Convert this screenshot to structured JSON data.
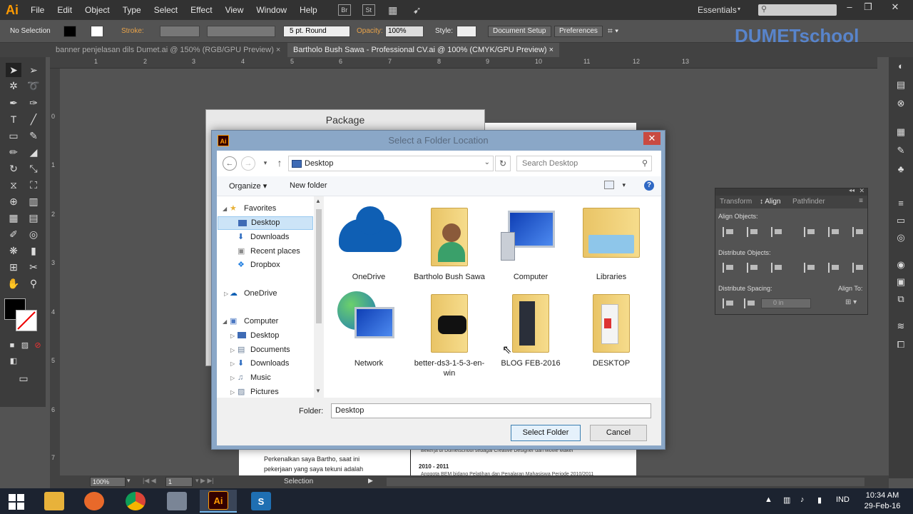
{
  "app": {
    "logo": "Ai",
    "menu": [
      "File",
      "Edit",
      "Object",
      "Type",
      "Select",
      "Effect",
      "View",
      "Window",
      "Help"
    ],
    "mb_icons": [
      "Br",
      "St"
    ],
    "workspace": "Essentials",
    "watermark": "DUMETschool"
  },
  "controlbar": {
    "selection": "No Selection",
    "stroke_label": "Stroke:",
    "brush": "5 pt. Round",
    "opacity_label": "Opacity:",
    "opacity_value": "100%",
    "style_label": "Style:",
    "doc_setup": "Document Setup",
    "preferences": "Preferences"
  },
  "tabs": [
    {
      "label": "banner penjelasan dils Dumet.ai @ 150% (RGB/GPU Preview)  ×"
    },
    {
      "label": "Bartholo Bush Sawa - Professional CV.ai @ 100% (CMYK/GPU Preview)  ×"
    }
  ],
  "ruler": {
    "top": [
      "1",
      "2",
      "3",
      "4",
      "5",
      "6",
      "7",
      "8",
      "9",
      "10",
      "11",
      "12",
      "13"
    ],
    "left": [
      "0",
      "1",
      "2",
      "3",
      "4",
      "5",
      "6",
      "7"
    ]
  },
  "canvas": {
    "text1": "Perkenalkan saya Bartho, saat ini",
    "text2": "pekerjaan yang saya tekuni adalah",
    "year": "2010 - 2011",
    "bullet": "Anggota BEM bidang Pelatihan dan Penalaran Mahasiswa Periode 2010/2011",
    "bullet0": "Bekerja di Dumetschool sebagai Creative Designer dan Movie Maker"
  },
  "package_dialog": {
    "title": "Package"
  },
  "folder_dialog": {
    "title": "Select a Folder Location",
    "address": "Desktop",
    "search_placeholder": "Search Desktop",
    "organize": "Organize ▾",
    "new_folder": "New folder",
    "tree": [
      {
        "label": "Favorites"
      },
      {
        "label": "Desktop"
      },
      {
        "label": "Downloads"
      },
      {
        "label": "Recent places"
      },
      {
        "label": "Dropbox"
      },
      {
        "label": "OneDrive"
      },
      {
        "label": "Computer"
      },
      {
        "label": "Desktop"
      },
      {
        "label": "Documents"
      },
      {
        "label": "Downloads"
      },
      {
        "label": "Music"
      },
      {
        "label": "Pictures"
      }
    ],
    "items": [
      {
        "label": "OneDrive"
      },
      {
        "label": "Bartholo Bush Sawa"
      },
      {
        "label": "Computer"
      },
      {
        "label": "Libraries"
      },
      {
        "label": "Network"
      },
      {
        "label": "better-ds3-1-5-3-en-win"
      },
      {
        "label": "BLOG FEB-2016"
      },
      {
        "label": "DESKTOP"
      }
    ],
    "folder_label": "Folder:",
    "folder_value": "Desktop",
    "select_button": "Select Folder",
    "cancel_button": "Cancel"
  },
  "align_panel": {
    "tabs": [
      "Transform",
      "↕ Align",
      "Pathfinder"
    ],
    "align_objects": "Align Objects:",
    "distribute_objects": "Distribute Objects:",
    "distribute_spacing": "Distribute Spacing:",
    "align_to": "Align To:",
    "spacing_value": "0 in"
  },
  "statusbar": {
    "zoom": "100%",
    "page": "1",
    "mode": "Selection"
  },
  "taskbar": {
    "clock_time": "10:34 AM",
    "clock_date": "29-Feb-16",
    "lang": "IND",
    "apps": [
      {
        "name": "file-explorer",
        "color": "#e8b23a"
      },
      {
        "name": "firefox",
        "color": "#e8692a"
      },
      {
        "name": "chrome",
        "color": "#3a9e4f"
      },
      {
        "name": "windows-tool",
        "color": "#7a8596"
      },
      {
        "name": "illustrator",
        "color": "#ff9a00"
      },
      {
        "name": "screen-recorder",
        "color": "#1f6fb2"
      }
    ]
  }
}
